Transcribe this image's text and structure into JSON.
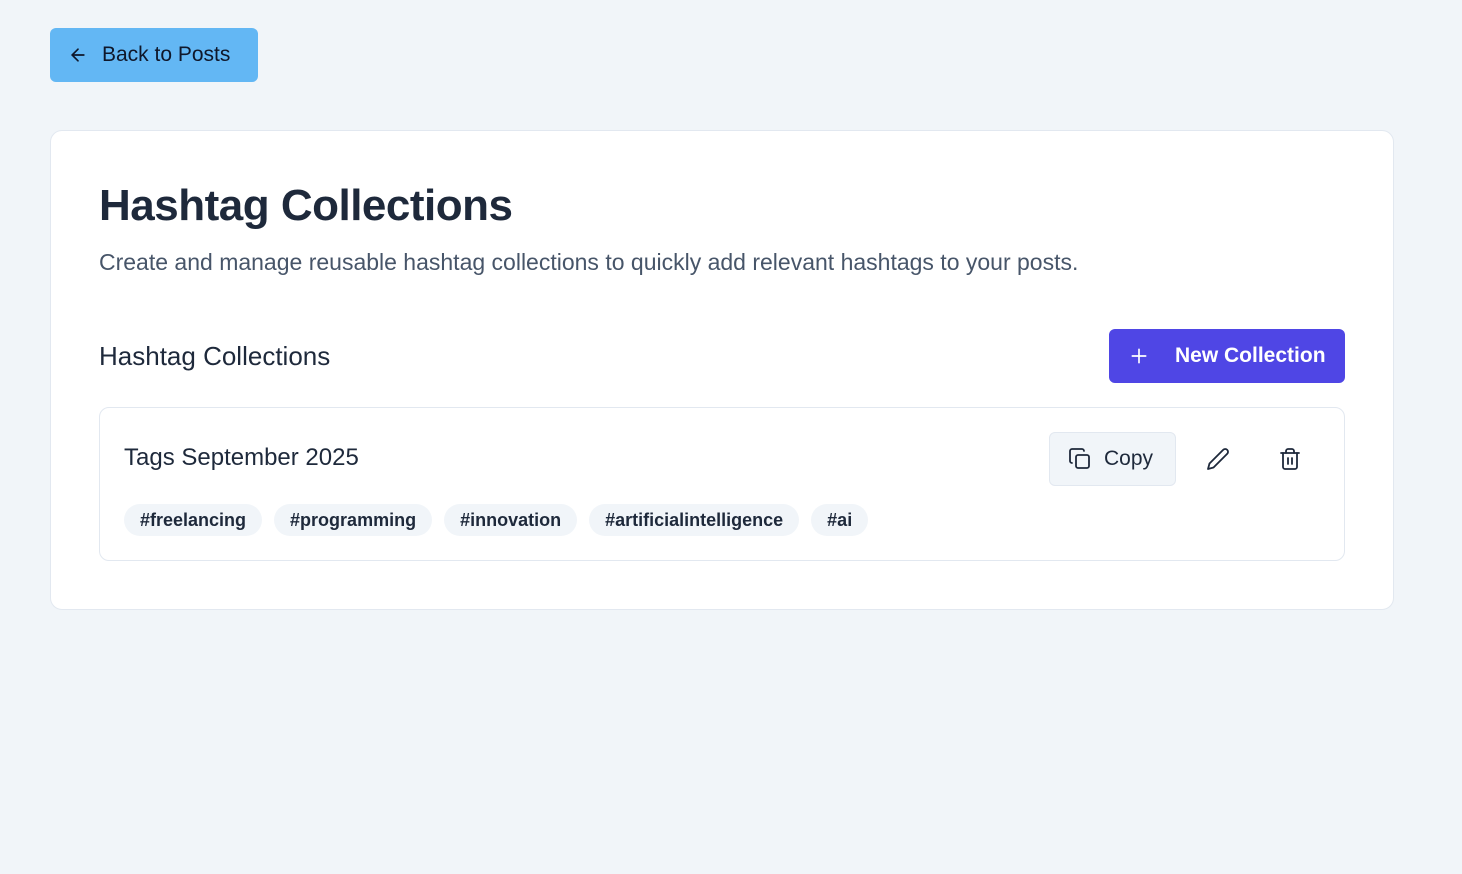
{
  "nav": {
    "back_label": "Back to Posts"
  },
  "header": {
    "title": "Hashtag Collections",
    "description": "Create and manage reusable hashtag collections to quickly add relevant hashtags to your posts."
  },
  "section": {
    "title": "Hashtag Collections",
    "new_button_label": "New Collection"
  },
  "collections": [
    {
      "name": "Tags September 2025",
      "copy_label": "Copy",
      "tags": [
        "#freelancing",
        "#programming",
        "#innovation",
        "#artificialintelligence",
        "#ai"
      ]
    }
  ],
  "icons": {
    "back": "arrow-left-icon",
    "new": "plus-icon",
    "copy": "copy-icon",
    "edit": "pencil-icon",
    "delete": "trash-icon"
  },
  "colors": {
    "background": "#f1f5f9",
    "back_button": "#63b7f4",
    "primary": "#4f46e5",
    "text": "#1e293b",
    "muted_text": "#475569",
    "tag_background": "#f1f5f9"
  }
}
